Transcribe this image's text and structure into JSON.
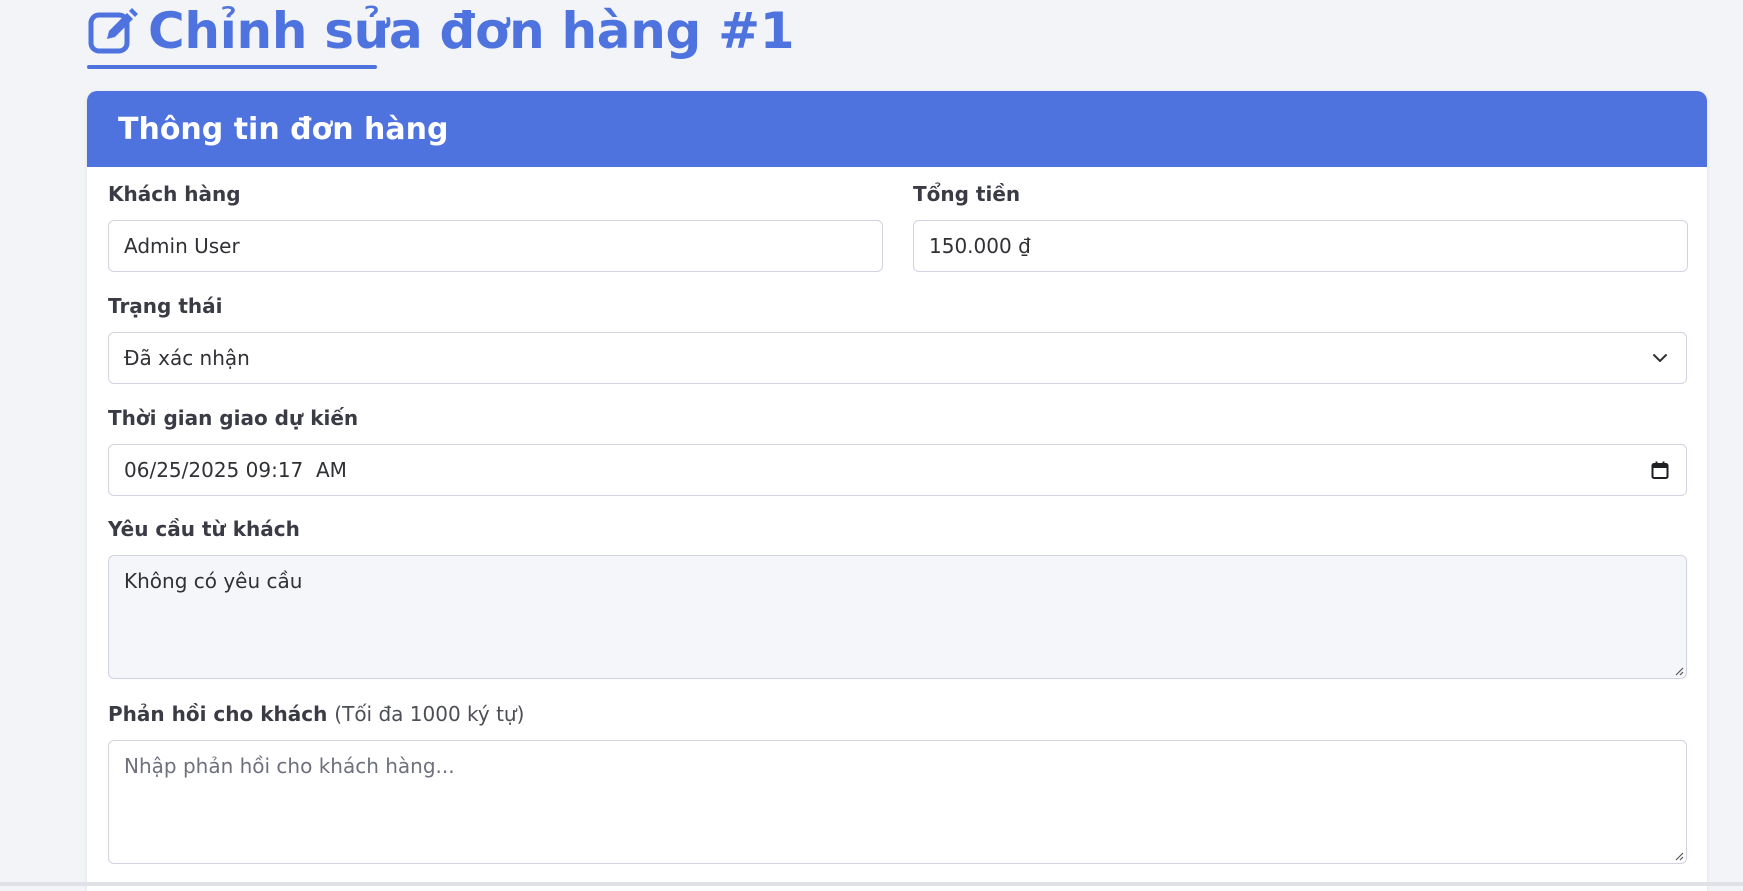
{
  "page": {
    "title": "Chỉnh sửa đơn hàng #1",
    "title_icon": "edit-icon"
  },
  "card": {
    "header": "Thông tin đơn hàng"
  },
  "form": {
    "customer": {
      "label": "Khách hàng",
      "value": "Admin User"
    },
    "total": {
      "label": "Tổng tiền",
      "value": "150.000 ₫"
    },
    "status": {
      "label": "Trạng thái",
      "selected": "Đã xác nhận"
    },
    "delivery_time": {
      "label": "Thời gian giao dự kiến",
      "value": "06/25/2025 09:17  AM"
    },
    "customer_request": {
      "label": "Yêu cầu từ khách",
      "value": "Không có yêu cầu"
    },
    "response": {
      "label": "Phản hồi cho khách",
      "label_hint": "(Tối đa 1000 ký tự)",
      "placeholder": "Nhập phản hồi cho khách hàng..."
    }
  },
  "colors": {
    "primary": "#4e73df",
    "background": "#f3f4f8",
    "border": "#d1d3e2"
  }
}
